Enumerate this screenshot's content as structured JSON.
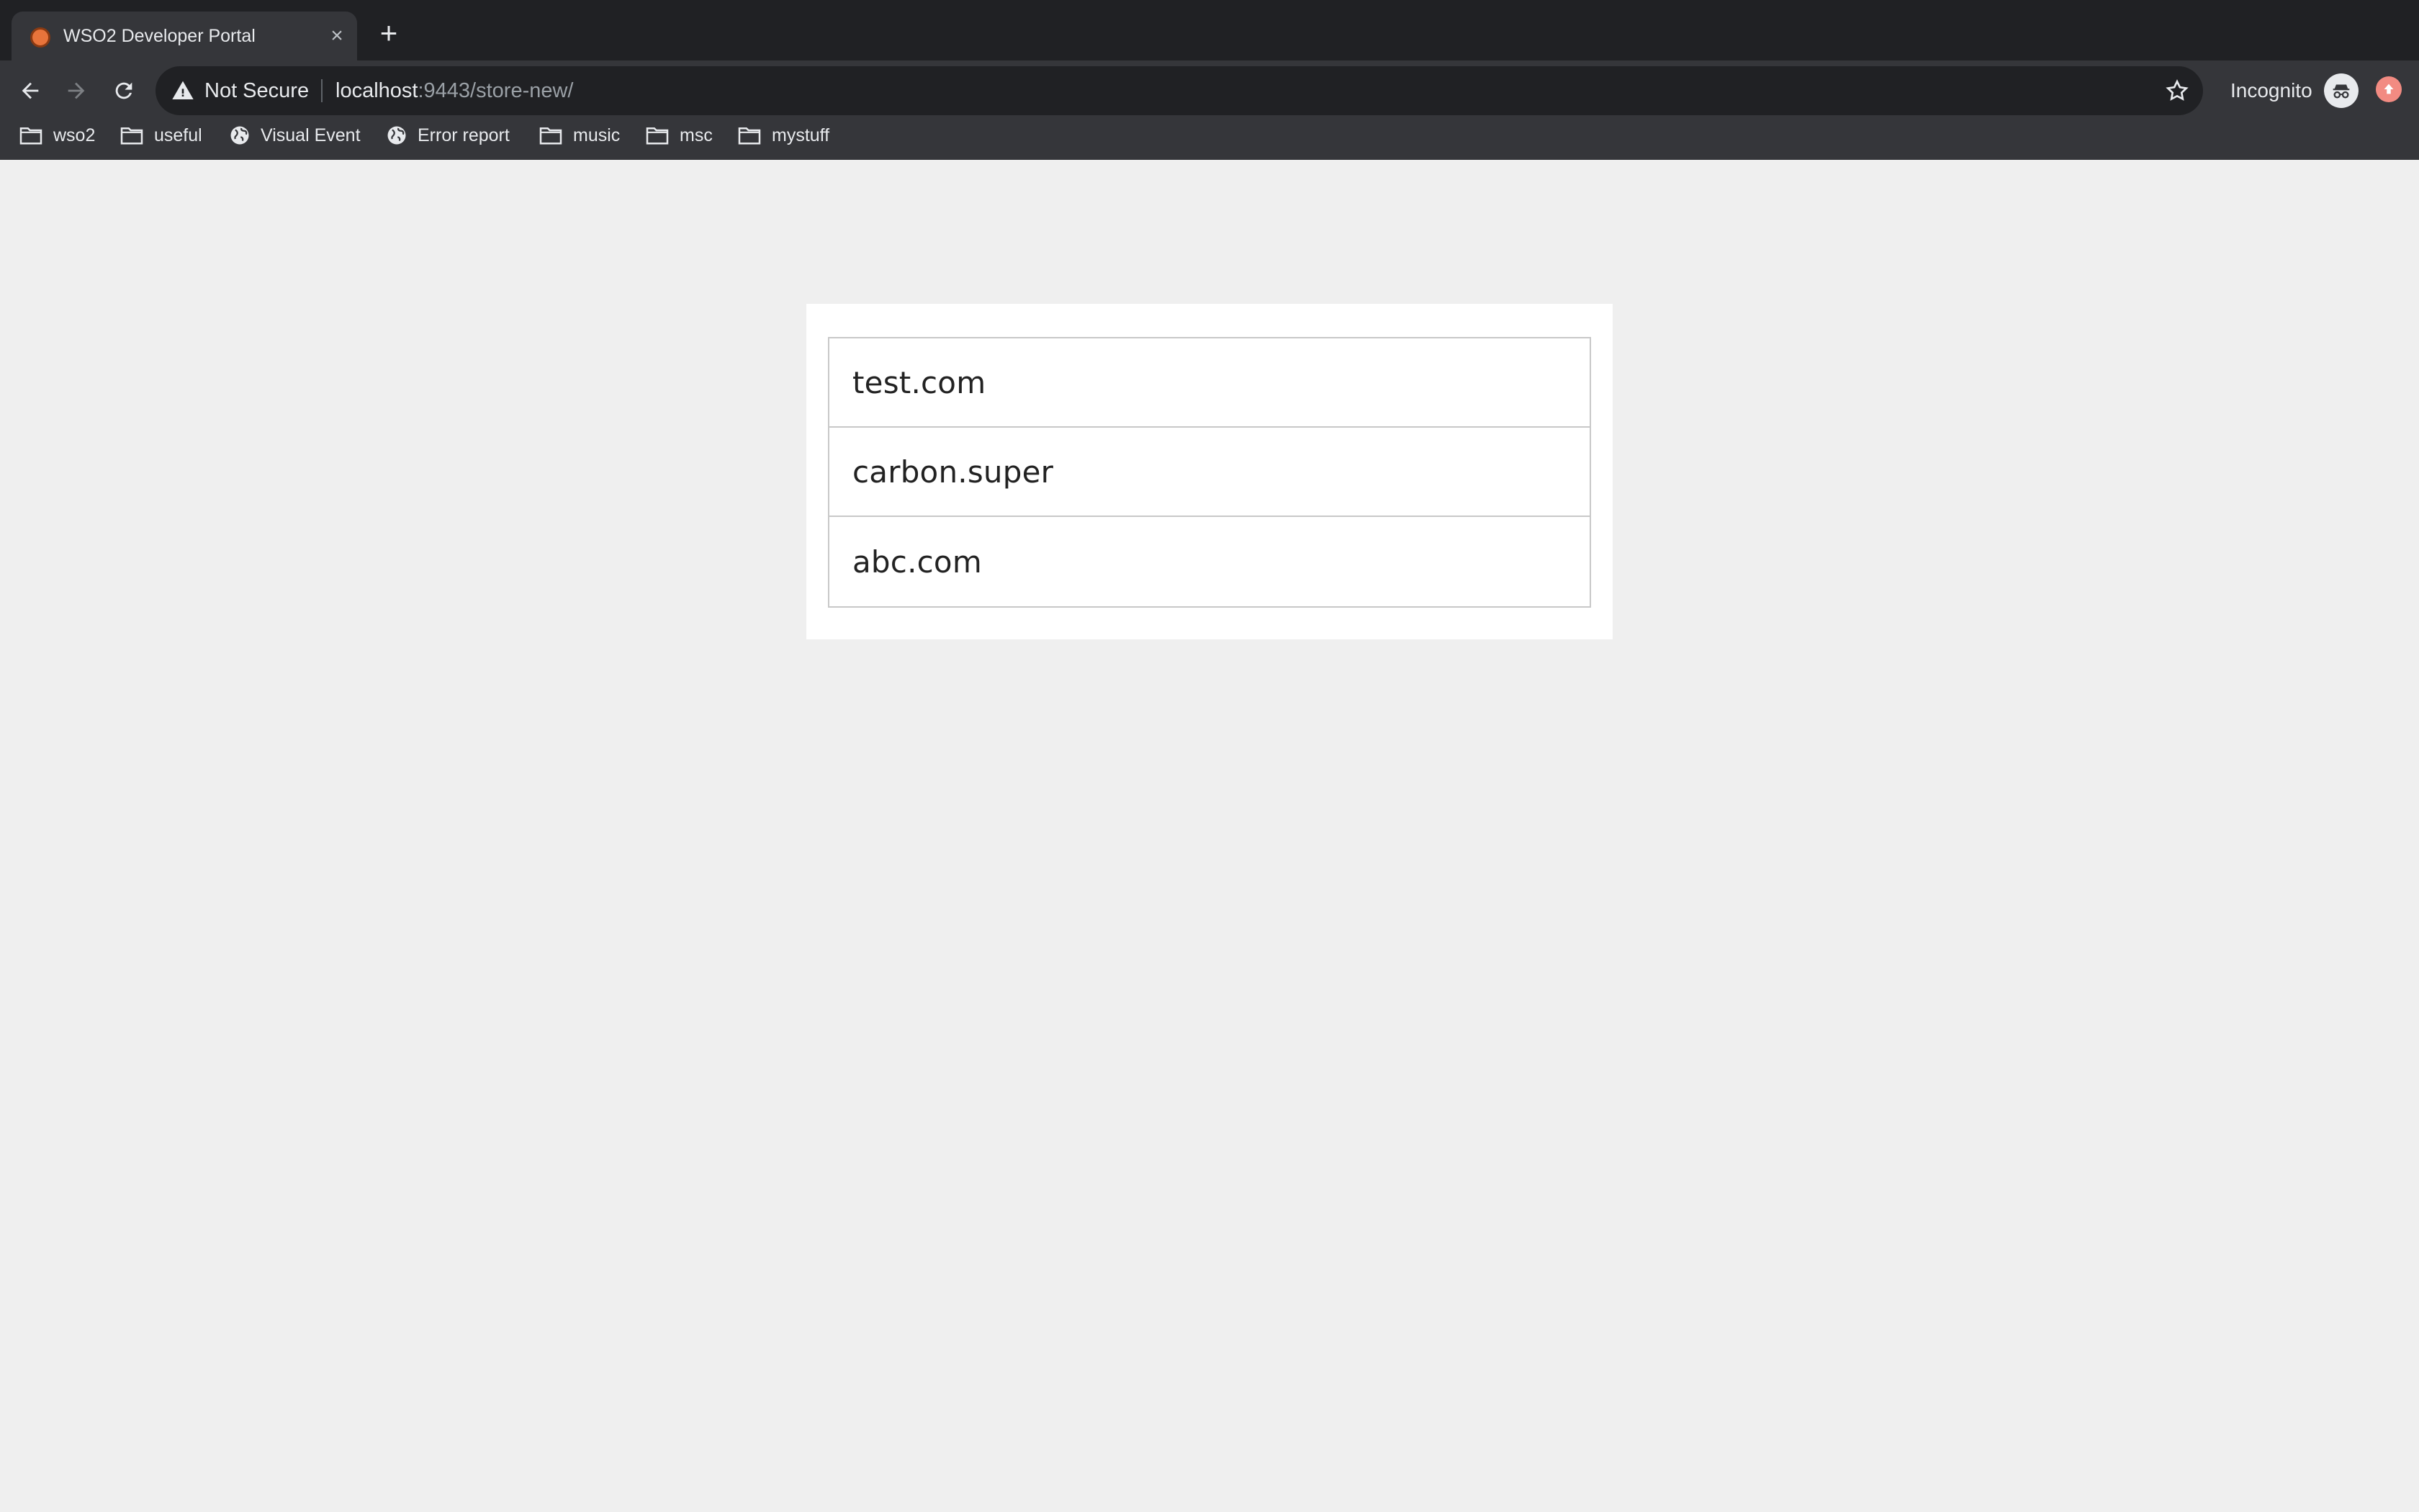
{
  "browser": {
    "tab": {
      "title": "WSO2 Developer Portal",
      "close_glyph": "×"
    },
    "new_tab_glyph": "+",
    "omnibox": {
      "security_label": "Not Secure",
      "url_host": "localhost",
      "url_rest": ":9443/store-new/"
    },
    "incognito_label": "Incognito",
    "bookmarks": [
      {
        "label": "wso2",
        "icon": "folder-icon"
      },
      {
        "label": "useful",
        "icon": "folder-icon"
      },
      {
        "label": "Visual Event",
        "icon": "globe-icon"
      },
      {
        "label": "Error report",
        "icon": "globe-icon"
      },
      {
        "label": "music",
        "icon": "folder-icon"
      },
      {
        "label": "msc",
        "icon": "folder-icon"
      },
      {
        "label": "mystuff",
        "icon": "folder-icon"
      }
    ]
  },
  "tenants": [
    {
      "label": "test.com"
    },
    {
      "label": "carbon.super"
    },
    {
      "label": "abc.com"
    }
  ],
  "colors": {
    "page_background": "#efefef",
    "chrome_dark": "#202124",
    "chrome_toolbar": "#35363a",
    "card": "#ffffff",
    "list_border": "#c8c8c8"
  }
}
